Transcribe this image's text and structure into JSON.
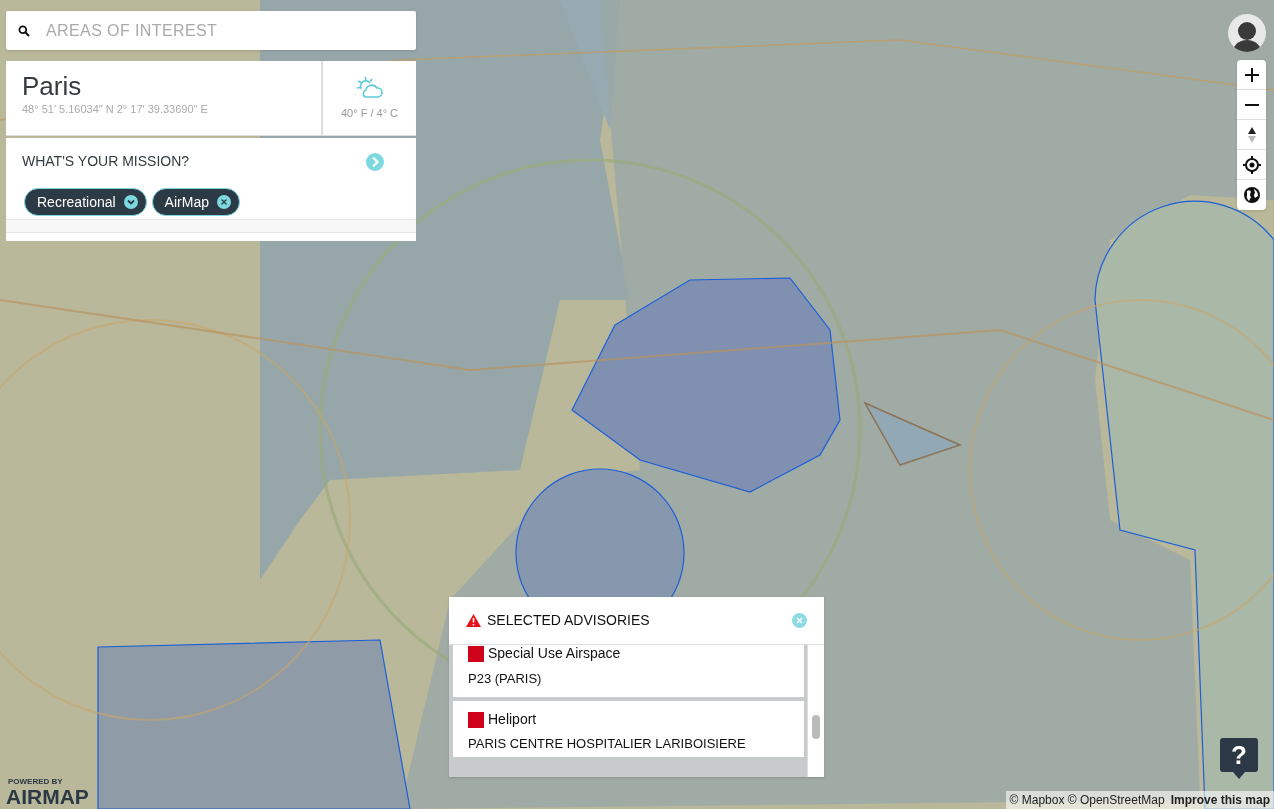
{
  "search": {
    "placeholder": "AREAS OF INTEREST"
  },
  "location": {
    "name": "Paris",
    "coordinates": "48° 51′ 5.16034″ N 2° 17′ 39.33690″ E",
    "weather": "40° F / 4° C"
  },
  "mission": {
    "title": "WHAT'S YOUR MISSION?",
    "chips": [
      {
        "label": "Recreational",
        "kind": "dropdown"
      },
      {
        "label": "AirMap",
        "kind": "removable"
      }
    ]
  },
  "advisories": {
    "title": "SELECTED ADVISORIES",
    "items": [
      {
        "category": "Special Use Airspace",
        "name": "P23 (PARIS)",
        "color": "#d0021b"
      },
      {
        "category": "Heliport",
        "name": "PARIS CENTRE HOSPITALIER LARIBOISIERE",
        "color": "#d0021b"
      }
    ]
  },
  "branding": {
    "tagline": "POWERED BY",
    "logo": "AIRMAP"
  },
  "attribution": {
    "credits": "© Mapbox © OpenStreetMap",
    "link": "Improve this map"
  },
  "help": {
    "label": "?"
  }
}
